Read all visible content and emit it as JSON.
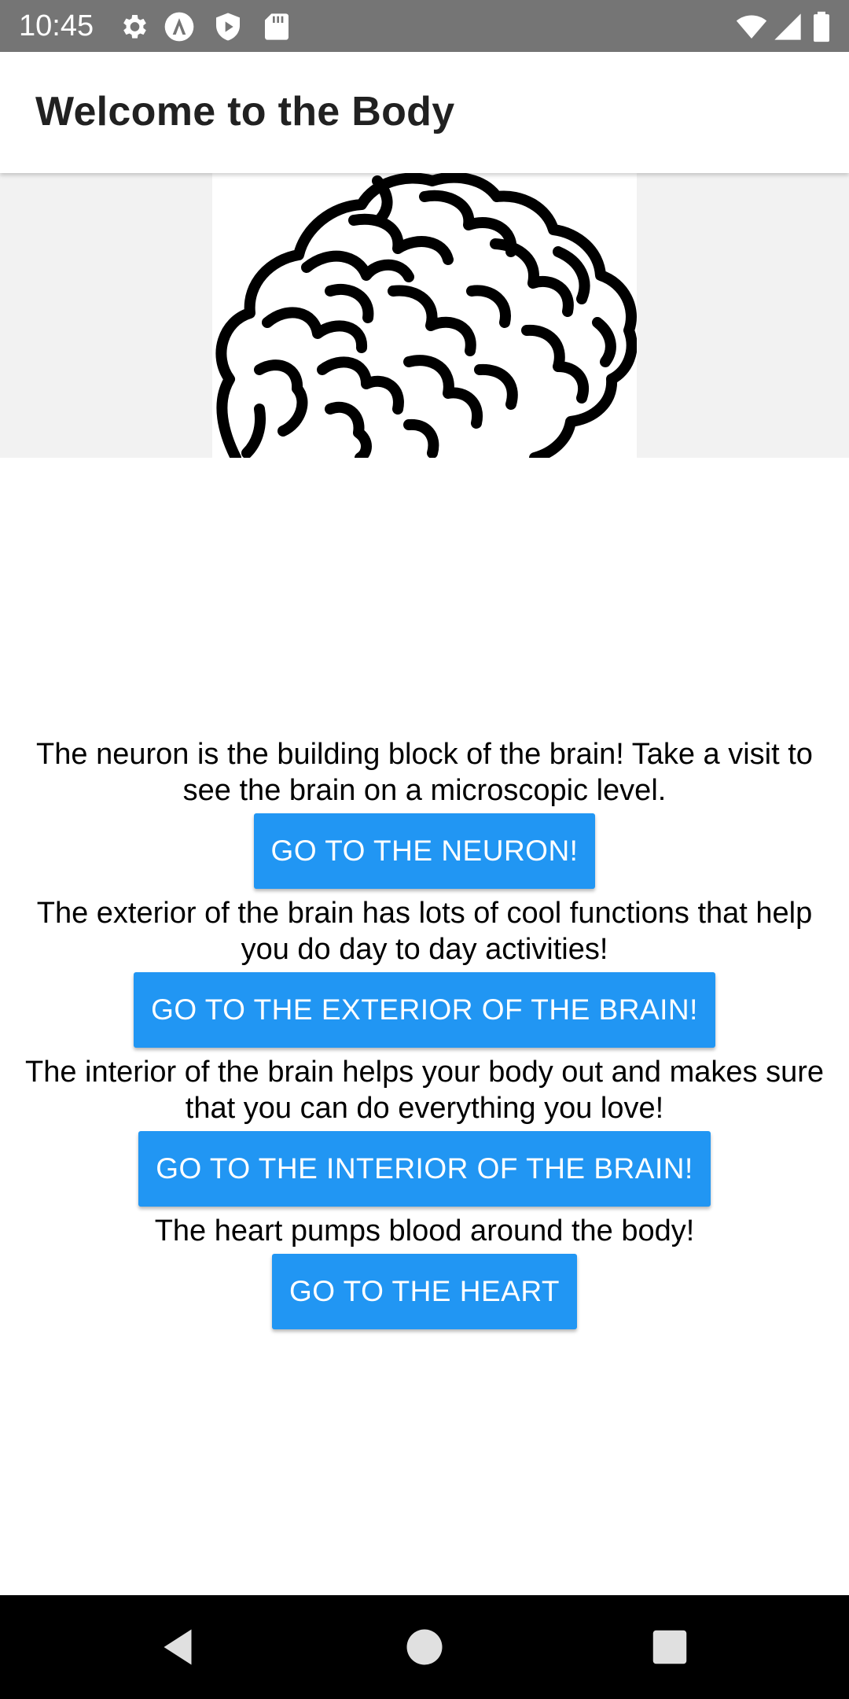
{
  "status_bar": {
    "time": "10:45",
    "icons": [
      "gear-icon",
      "a-badge-icon",
      "shield-play-icon",
      "sd-card-icon",
      "wifi-icon",
      "signal-icon",
      "battery-icon"
    ],
    "background": "#757575"
  },
  "app_bar": {
    "title": "Welcome to the Body"
  },
  "hero": {
    "image": "brain-illustration"
  },
  "sections": [
    {
      "description": "The neuron is the building block of the brain! Take a visit to see the brain on a microscopic level.",
      "button_label": "GO TO THE NEURON!"
    },
    {
      "description": "The exterior of the brain has lots of cool functions that help you do day to day activities!",
      "button_label": "GO TO THE EXTERIOR OF THE BRAIN!"
    },
    {
      "description": "The interior of the brain helps your body out and makes sure that you can do everything you love!",
      "button_label": "GO TO THE INTERIOR OF THE BRAIN!"
    },
    {
      "description": "The heart pumps blood around the body!",
      "button_label": "GO TO THE HEART"
    }
  ],
  "colors": {
    "button": "#2196f3",
    "button_text": "#ffffff",
    "nav_bar": "#000000"
  },
  "nav_bar": {
    "buttons": [
      "back-icon",
      "home-icon",
      "recents-icon"
    ]
  }
}
